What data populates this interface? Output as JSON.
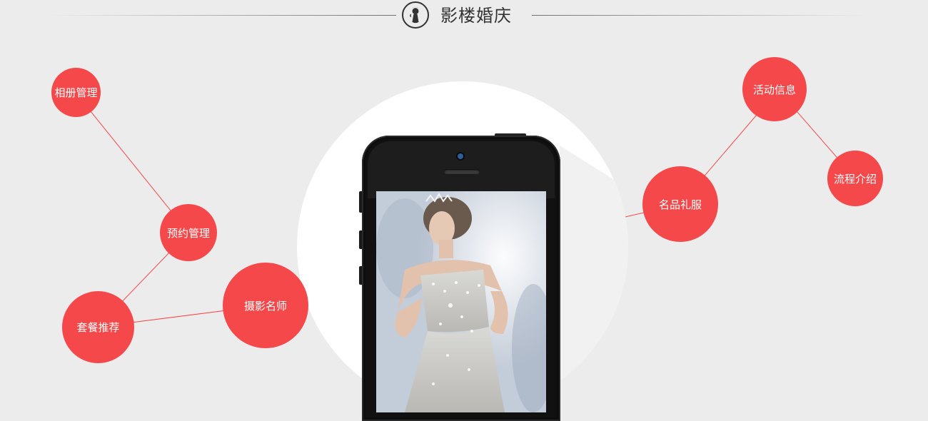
{
  "header": {
    "title": "影楼婚庆",
    "logo_icon": "bride-silhouette-icon"
  },
  "bubbles": [
    {
      "id": "album",
      "label": "相册管理"
    },
    {
      "id": "booking",
      "label": "预约管理"
    },
    {
      "id": "package",
      "label": "套餐推荐"
    },
    {
      "id": "photographer",
      "label": "摄影名师"
    },
    {
      "id": "event",
      "label": "活动信息"
    },
    {
      "id": "dress",
      "label": "名品礼服"
    },
    {
      "id": "process",
      "label": "流程介绍"
    }
  ],
  "phone": {
    "screen_image": "bride-in-wedding-dress"
  },
  "colors": {
    "background": "#ececec",
    "bubble": "#f5484a",
    "bubble_text": "#ffffff",
    "line": "#f5484a"
  }
}
